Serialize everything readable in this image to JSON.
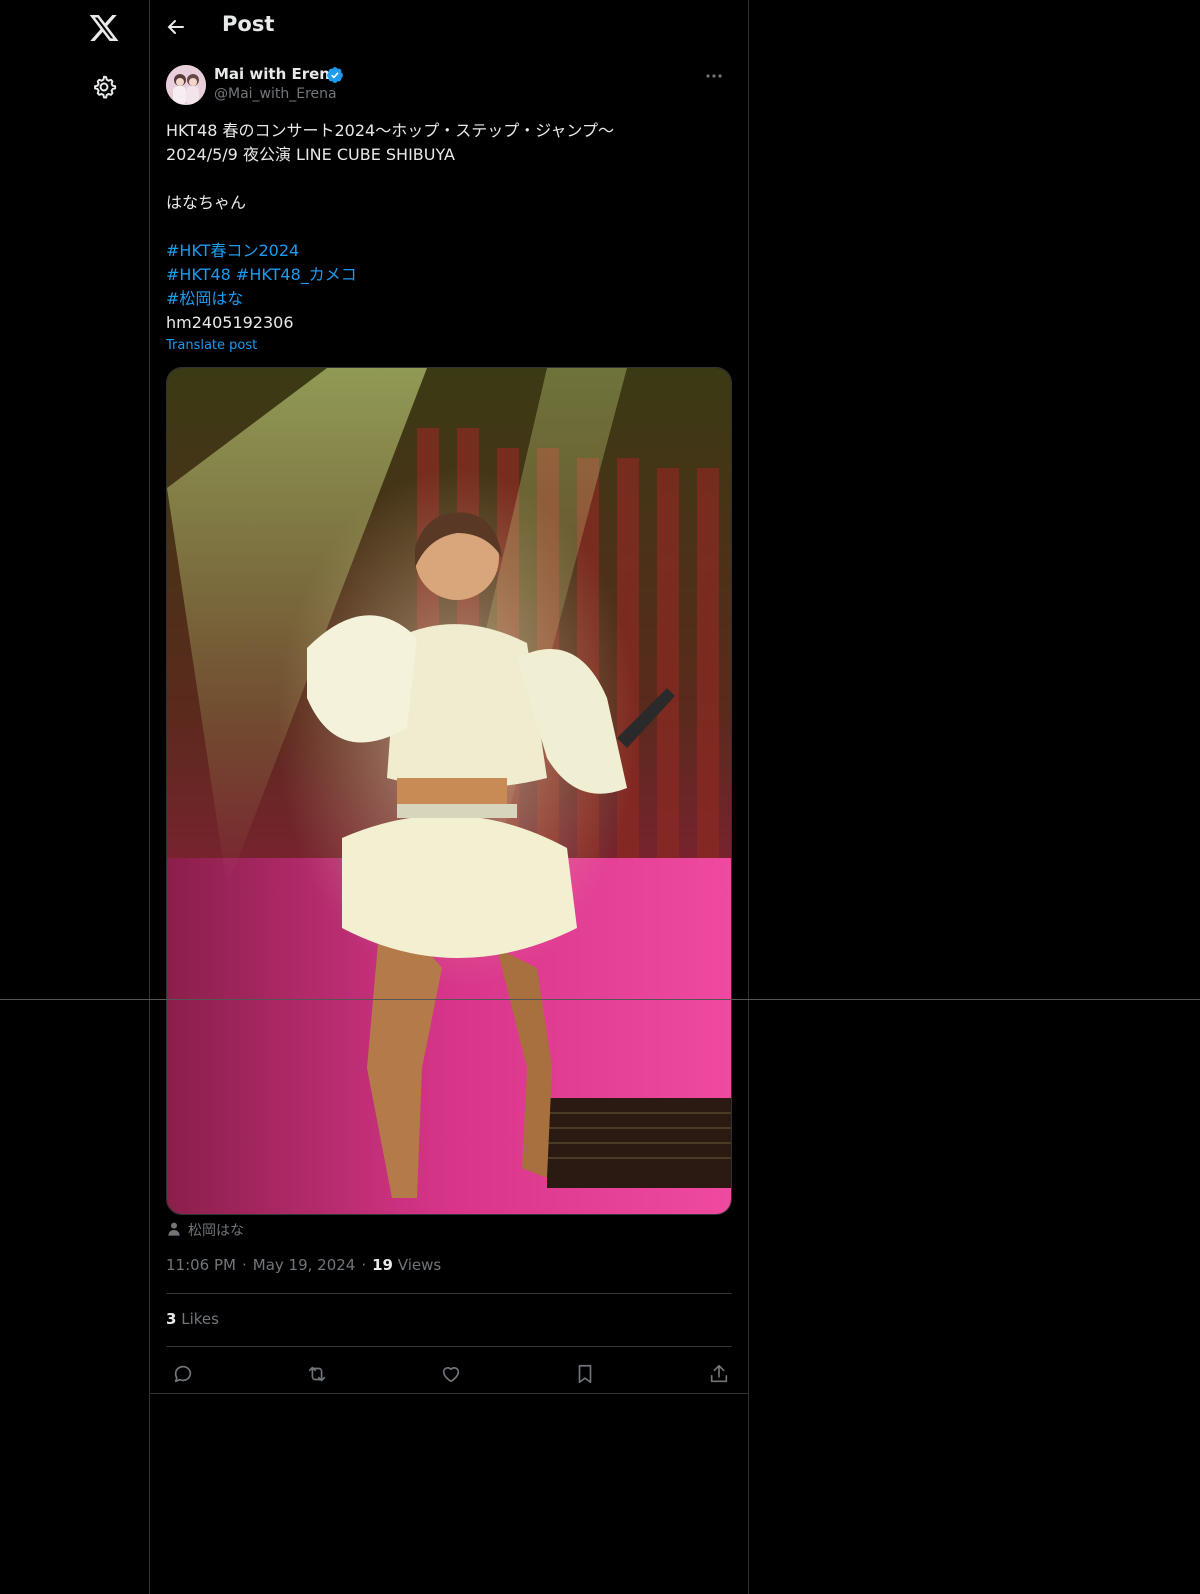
{
  "nav": {
    "logo_icon": "x-logo-icon",
    "settings_icon": "gear-icon"
  },
  "header": {
    "back_icon": "arrow-left-icon",
    "title": "Post"
  },
  "post": {
    "author": {
      "name": "Mai with Erena",
      "handle": "@Mai_with_Erena",
      "verified": true
    },
    "lines": [
      "HKT48 春のコンサート2024〜ホップ・ステップ・ジャンプ〜",
      "2024/5/9 夜公演 LINE CUBE SHIBUYA",
      "",
      "はなちゃん",
      ""
    ],
    "hashtags": {
      "h1": "#HKT春コン2024",
      "h2": "#HKT48",
      "h3": "#HKT48_カメコ",
      "h4": "#松岡はな"
    },
    "code": "hm2405192306",
    "translate_label": "Translate post",
    "tagged_person": "松岡はな",
    "time": "11:06 PM",
    "date": "May 19, 2024",
    "views_count": "19",
    "views_label": "Views",
    "likes_count": "3",
    "likes_label": "Likes"
  },
  "colors": {
    "background": "#000000",
    "text": "#e7e9ea",
    "muted": "#71767b",
    "link": "#1d9bf0",
    "border": "#2f3336"
  }
}
